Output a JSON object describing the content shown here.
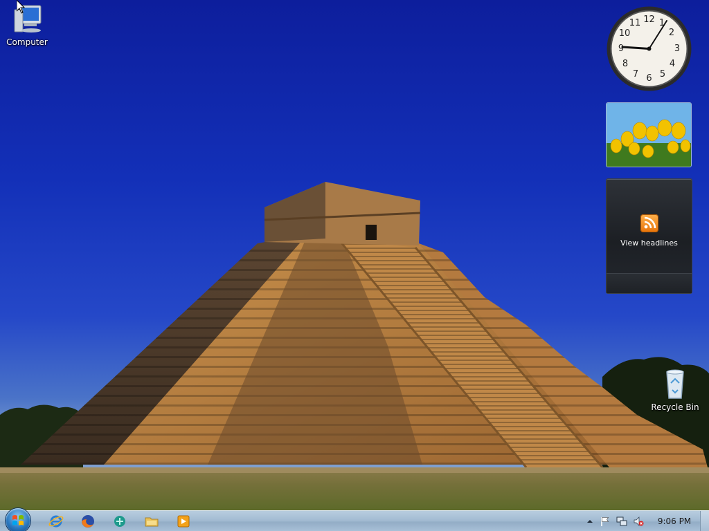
{
  "desktop": {
    "icons": [
      {
        "label": "Computer",
        "icon": "computer-icon"
      },
      {
        "label": "Recycle Bin",
        "icon": "recycle-bin-icon"
      }
    ]
  },
  "gadgets": {
    "clock": {
      "hours": 9,
      "minutes": 6
    },
    "slideshow": {
      "subject": "yellow tulips"
    },
    "feed_headlines": {
      "label": "View headlines",
      "icon": "rss-feed-icon"
    }
  },
  "taskbar": {
    "start_button": "start-orb-icon",
    "pinned_apps": [
      "internet-explorer-icon",
      "firefox-icon",
      "app-icon",
      "windows-explorer-icon",
      "media-player-icon"
    ],
    "tray": {
      "icons": [
        "show-hidden-icons-chevron",
        "action-center-flag-icon",
        "network-icon",
        "volume-muted-icon"
      ],
      "time": "9:06 PM"
    }
  },
  "colors": {
    "sky": "#1330b8",
    "taskbar": "#a3bbd2",
    "feed_orange": "#e8740a"
  }
}
